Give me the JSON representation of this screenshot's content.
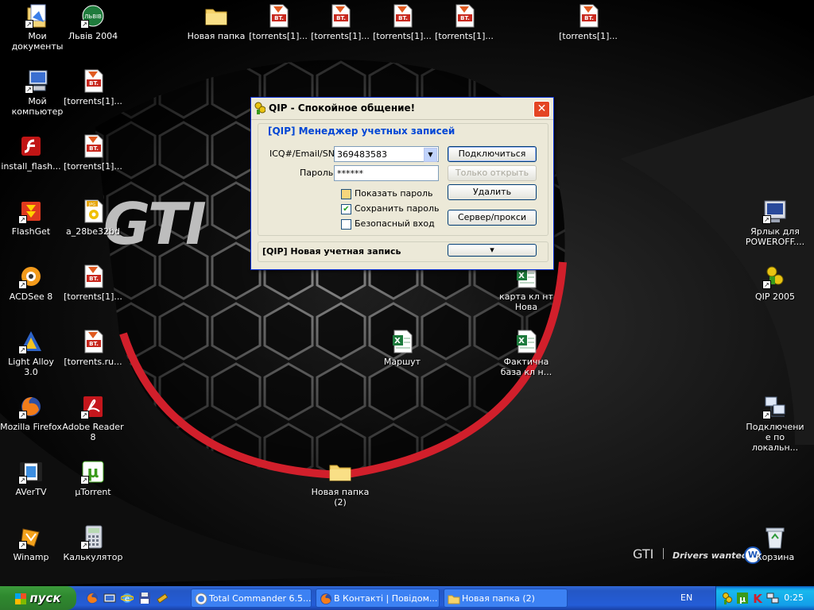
{
  "desktop": {
    "wallpaper_text": {
      "grille_badge": "GTI",
      "brand": "GTI",
      "slogan": "Drivers wanted."
    },
    "icons": [
      {
        "label": "Мои документы",
        "icon": "my-documents-icon"
      },
      {
        "label": "Львів 2004",
        "icon": "lviv-logo-icon",
        "badge": "ЛЬВІВ"
      },
      {
        "label": "Новая папка",
        "icon": "folder-icon"
      },
      {
        "label": "[torrents[1]...",
        "icon": "torrent-file-icon",
        "badge": "BT."
      },
      {
        "label": "[torrents[1]...",
        "icon": "torrent-file-icon",
        "badge": "BT."
      },
      {
        "label": "[torrents[1]...",
        "icon": "torrent-file-icon",
        "badge": "BT."
      },
      {
        "label": "[torrents[1]...",
        "icon": "torrent-file-icon",
        "badge": "BT."
      },
      {
        "label": "[torrents[1]...",
        "icon": "torrent-file-icon",
        "badge": "BT."
      },
      {
        "label": "Мой компьютер",
        "icon": "my-computer-icon"
      },
      {
        "label": "[torrents[1]...",
        "icon": "torrent-file-icon",
        "badge": "BT."
      },
      {
        "label": "install_flash...",
        "icon": "flash-installer-icon"
      },
      {
        "label": "[torrents[1]...",
        "icon": "torrent-file-icon",
        "badge": "BT."
      },
      {
        "label": "FlashGet",
        "icon": "flashget-icon"
      },
      {
        "label": "a_28be32bd",
        "icon": "jpg-file-icon",
        "badge": "JPG"
      },
      {
        "label": "ACDSee 8",
        "icon": "acdsee-icon"
      },
      {
        "label": "[torrents[1]...",
        "icon": "torrent-file-icon",
        "badge": "BT."
      },
      {
        "label": "Light Alloy 3.0",
        "icon": "light-alloy-icon"
      },
      {
        "label": "[torrents.ru...",
        "icon": "torrent-file-icon",
        "badge": "BT."
      },
      {
        "label": "Mozilla Firefox",
        "icon": "firefox-icon"
      },
      {
        "label": "Adobe Reader 8",
        "icon": "adobe-reader-icon"
      },
      {
        "label": "AVerTV",
        "icon": "avertv-icon"
      },
      {
        "label": "µTorrent",
        "icon": "utorrent-icon",
        "badge": "µ"
      },
      {
        "label": "Winamp",
        "icon": "winamp-icon"
      },
      {
        "label": "Калькулятор",
        "icon": "calculator-icon"
      },
      {
        "label": "Новая папка (2)",
        "icon": "folder-icon"
      },
      {
        "label": "Маршут",
        "icon": "excel-file-icon"
      },
      {
        "label": "карта кл нт Нова",
        "icon": "excel-file-icon"
      },
      {
        "label": "Фактична база кл н...",
        "icon": "excel-file-icon"
      },
      {
        "label": "Ярлык для POWEROFF....",
        "icon": "poweroff-shortcut-icon"
      },
      {
        "label": "QIP 2005",
        "icon": "qip-icon"
      },
      {
        "label": "Подключение по локальн...",
        "icon": "network-connection-icon"
      },
      {
        "label": "Корзина",
        "icon": "recycle-bin-icon"
      }
    ]
  },
  "qip": {
    "title": "QIP - Спокойное общение!",
    "close_label": "✕",
    "group_title": "[QIP] Менеджер учетных записей",
    "uin_label": "ICQ#/Email/SN:",
    "uin_value": "369483583",
    "password_label": "Пароль:",
    "password_value": "******",
    "connect_label": "Подключиться",
    "open_only_label": "Только открыть",
    "delete_label": "Удалить",
    "server_label": "Сервер/прокси",
    "show_password_label": "Показать пароль",
    "save_password_label": "Сохранить пароль",
    "secure_login_label": "Безопасный вход",
    "save_password_checked": true,
    "new_account_label": "[QIP] Новая учетная запись",
    "new_account_dropdown": "▾"
  },
  "taskbar": {
    "start_label": "пуск",
    "tasks": [
      {
        "label": "Total Commander 6.5...",
        "icon": "total-commander-icon"
      },
      {
        "label": "В Контакті | Повідом...",
        "icon": "firefox-icon"
      },
      {
        "label": "Новая папка (2)",
        "icon": "folder-icon"
      }
    ],
    "language": "EN",
    "clock": "0:25"
  },
  "colors": {
    "taskbar_blue": "#245dd7",
    "start_green": "#2f8a2f",
    "dialog_bg": "#ece9d8",
    "group_title_blue": "#0046d5",
    "close_red": "#e44524"
  }
}
